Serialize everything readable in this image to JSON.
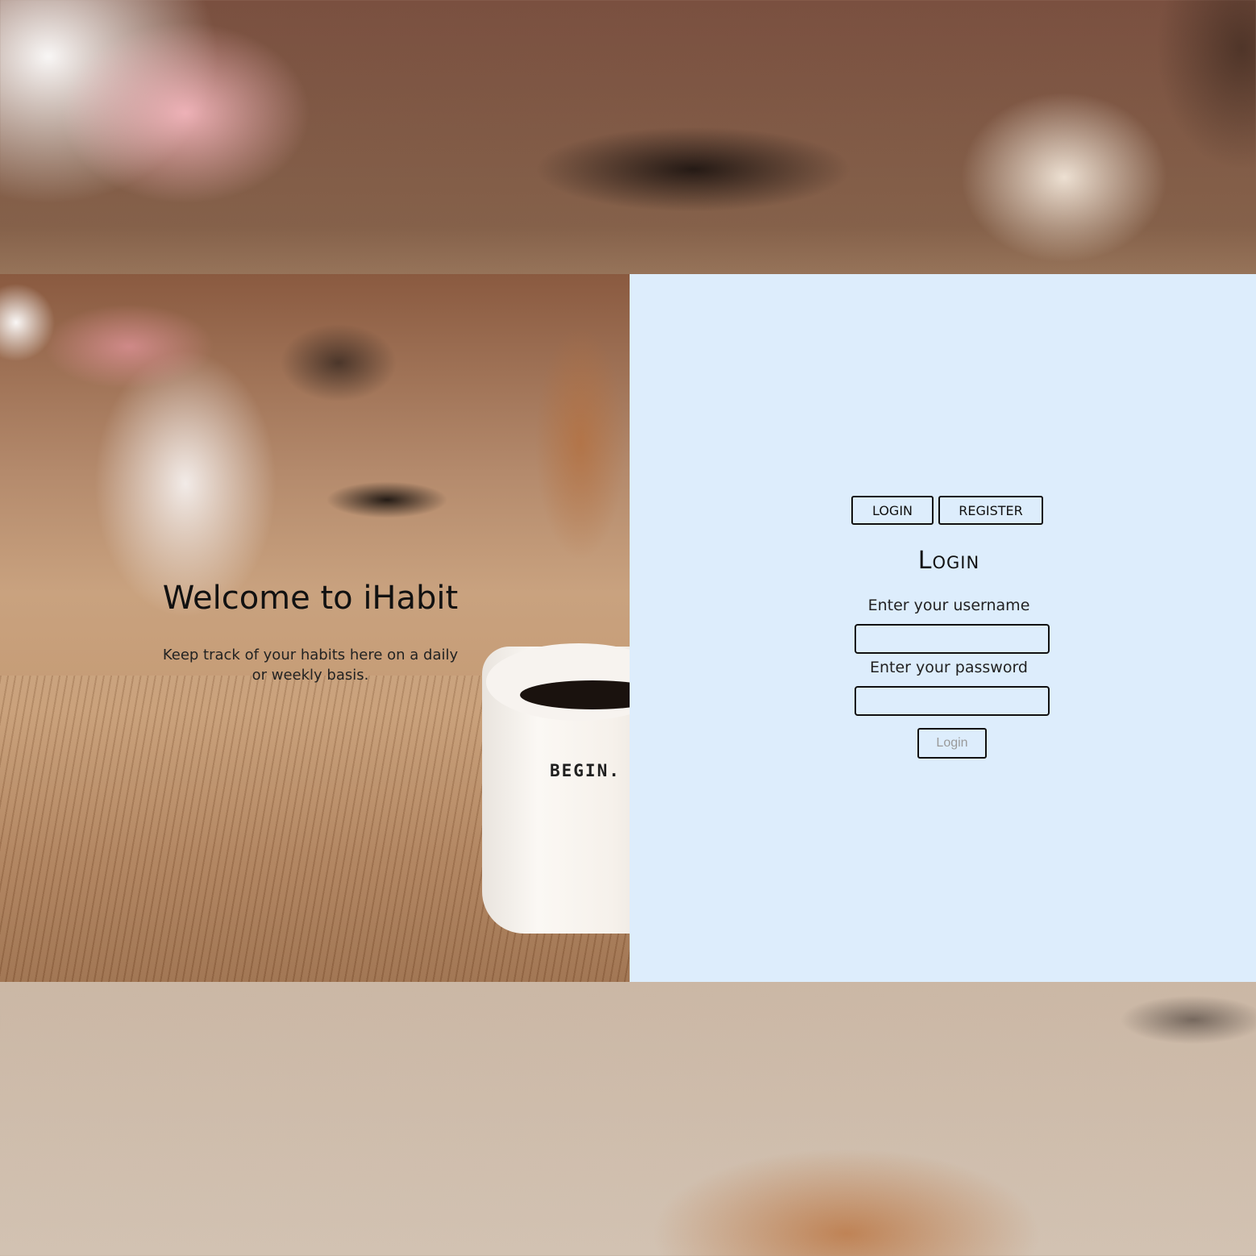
{
  "hero": {
    "title": "Welcome to iHabit",
    "subtitle": "Keep track of your habits here on a daily or weekly basis.",
    "mug_text": "BEGIN."
  },
  "auth": {
    "tabs": {
      "login_label": "LOGIN",
      "register_label": "REGISTER"
    },
    "form": {
      "heading": "Login",
      "username_label": "Enter your username",
      "username_value": "",
      "password_label": "Enter your password",
      "password_value": "",
      "submit_label": "Login"
    }
  },
  "colors": {
    "panel_background": "#ddedfc",
    "border": "#111111",
    "submit_text": "#9a9a9a"
  }
}
